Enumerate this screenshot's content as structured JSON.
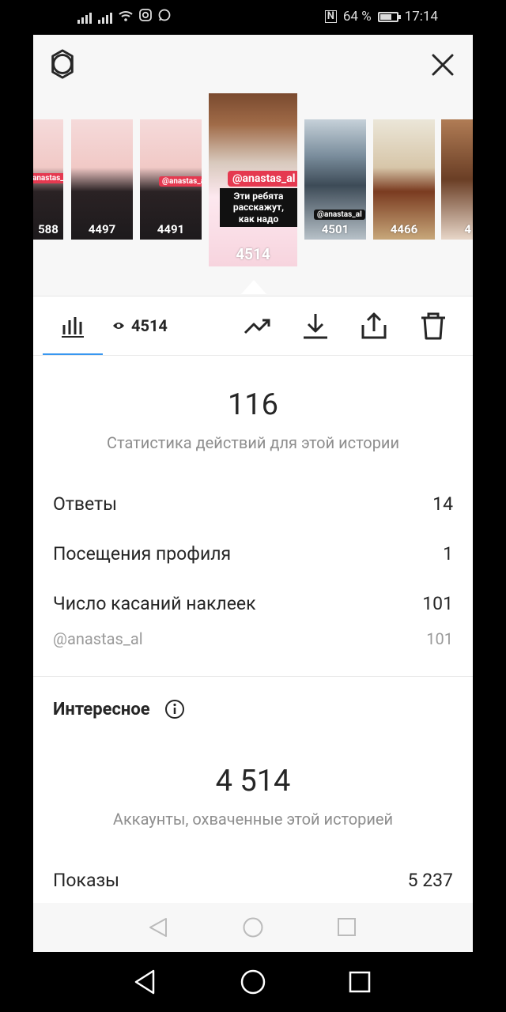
{
  "status_bar": {
    "nfc_label": "N",
    "battery_percent": "64 %",
    "battery_level": 0.64,
    "time": "17:14"
  },
  "header": {
    "settings_icon": "gear-icon",
    "close_icon": "close-icon"
  },
  "stories": [
    {
      "views": "588",
      "tag": "@anastas_al",
      "type": "face"
    },
    {
      "views": "4497",
      "type": "face"
    },
    {
      "views": "4491",
      "tag": "@anastas_al",
      "type": "face"
    },
    {
      "views": "4514",
      "type": "city",
      "selected": true
    },
    {
      "views": "4501",
      "tag": "@anastas_al",
      "type": "sea"
    },
    {
      "views": "4466",
      "type": "cake"
    },
    {
      "views": "4",
      "type": "partial"
    }
  ],
  "selected_story": {
    "tag": "@anastas_al",
    "caption_line1": "Эти ребята",
    "caption_line2": "расскажут, как надо"
  },
  "toolbar": {
    "views": "4514",
    "insights_icon": "bar-chart-icon",
    "trend_icon": "trend-up-icon",
    "download_icon": "download-icon",
    "share_icon": "share-icon",
    "delete_icon": "trash-icon"
  },
  "actions": {
    "total": "116",
    "caption": "Статистика действий для этой истории",
    "rows": [
      {
        "label": "Ответы",
        "value": "14"
      },
      {
        "label": "Посещения профиля",
        "value": "1"
      },
      {
        "label": "Число касаний наклеек",
        "value": "101"
      }
    ],
    "sub_row": {
      "label": "@anastas_al",
      "value": "101"
    }
  },
  "discovery": {
    "title": "Интересное",
    "reach": "4 514",
    "caption": "Аккаунты, охваченные этой историей",
    "impressions_label": "Показы",
    "impressions_value": "5 237"
  },
  "colors": {
    "accent": "#3897f0",
    "sticker_red": "#e53950"
  }
}
